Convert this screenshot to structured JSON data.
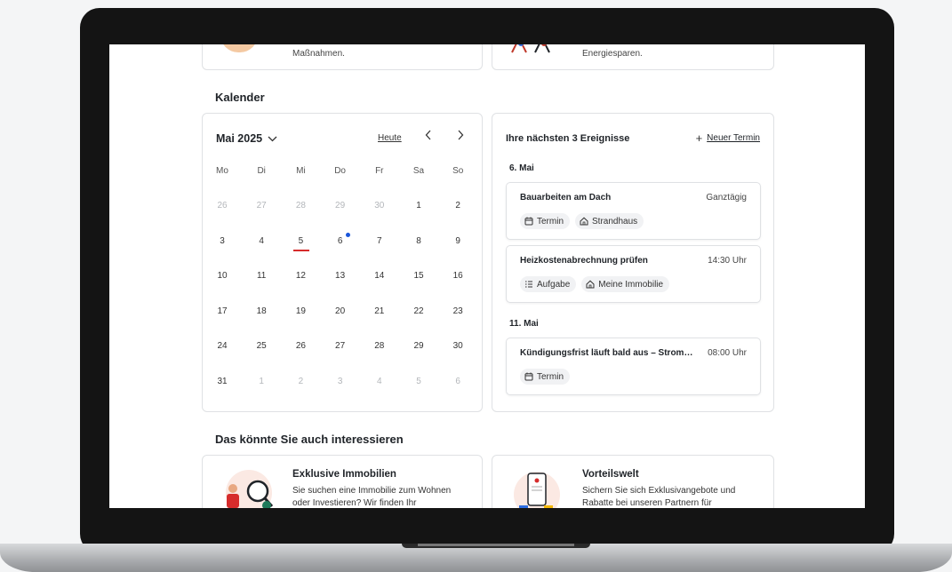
{
  "top_cards": [
    {
      "text": "Maßnahmen."
    },
    {
      "text": "Energiesparen."
    }
  ],
  "calendar": {
    "section_title": "Kalender",
    "month_label": "Mai 2025",
    "today_label": "Heute",
    "prev_label": "‹",
    "next_label": "›",
    "weekdays": [
      "Mo",
      "Di",
      "Mi",
      "Do",
      "Fr",
      "Sa",
      "So"
    ],
    "weeks": [
      [
        "26",
        "27",
        "28",
        "29",
        "30",
        "1",
        "2"
      ],
      [
        "3",
        "4",
        "5",
        "6",
        "7",
        "8",
        "9"
      ],
      [
        "10",
        "11",
        "12",
        "13",
        "14",
        "15",
        "16"
      ],
      [
        "17",
        "18",
        "19",
        "20",
        "21",
        "22",
        "23"
      ],
      [
        "24",
        "25",
        "26",
        "27",
        "28",
        "29",
        "30"
      ],
      [
        "31",
        "1",
        "2",
        "3",
        "4",
        "5",
        "6"
      ]
    ],
    "today": "5",
    "event_day": "6",
    "colors": {
      "today_underline": "#d62c2c",
      "event_dot": "#1a56db"
    }
  },
  "events": {
    "title": "Ihre nächsten 3 Ereignisse",
    "new_label": "Neuer Termin",
    "groups": [
      {
        "date": "6. Mai",
        "items": [
          {
            "name": "Bauarbeiten am Dach",
            "time": "Ganztägig",
            "chips": [
              {
                "icon": "calendar-icon",
                "label": "Termin"
              },
              {
                "icon": "house-icon",
                "label": "Strandhaus"
              }
            ]
          },
          {
            "name": "Heizkostenabrechnung prüfen",
            "time": "14:30 Uhr",
            "chips": [
              {
                "icon": "task-list-icon",
                "label": "Aufgabe"
              },
              {
                "icon": "house-icon",
                "label": "Meine Immobilie"
              }
            ]
          }
        ]
      },
      {
        "date": "11. Mai",
        "items": [
          {
            "name": "Kündigungsfrist läuft bald aus – Strom…",
            "time": "08:00 Uhr",
            "chips": [
              {
                "icon": "calendar-icon",
                "label": "Termin"
              }
            ]
          }
        ]
      }
    ]
  },
  "interest": {
    "section_title": "Das könnte Sie auch interessieren",
    "cards": [
      {
        "title": "Exklusive Immobilien",
        "text": "Sie suchen eine Immobilie zum Wohnen oder Investieren? Wir finden Ihr"
      },
      {
        "title": "Vorteilswelt",
        "text": "Sichern Sie sich Exklusivangebote und Rabatte bei unseren Partnern für"
      }
    ]
  }
}
